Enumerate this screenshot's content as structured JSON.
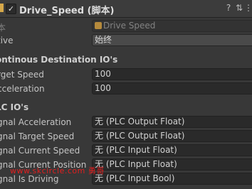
{
  "header": {
    "title": "Drive_Speed",
    "subtitle": "(脚本)",
    "enabled_checkmark": "✓",
    "help_icon": "?",
    "settings_icon": "⇅",
    "menu_icon": "⋮"
  },
  "script_row": {
    "label": "本",
    "value": "Drive Speed"
  },
  "active_row": {
    "label": "tive",
    "value": "始终"
  },
  "section_continuous": "ontinous Destination IO's",
  "target_speed": {
    "label": "rget Speed",
    "value": "100"
  },
  "acceleration": {
    "label": "cceleration",
    "value": "100"
  },
  "section_plc": "LC IO's",
  "plc_rows": [
    {
      "label": "gnal Acceleration",
      "value": "无 (PLC Output Float)"
    },
    {
      "label": "gnal Target Speed",
      "value": "无 (PLC Output Float)"
    },
    {
      "label": "gnal Current Speed",
      "value": "无 (PLC Input Float)"
    },
    {
      "label": "gnal Current Position",
      "value": "无 (PLC Input Float)"
    },
    {
      "label": "gnal Is Driving",
      "value": "无 (PLC Input Bool)"
    }
  ],
  "watermark": "www.skcircle.com 勇哥"
}
